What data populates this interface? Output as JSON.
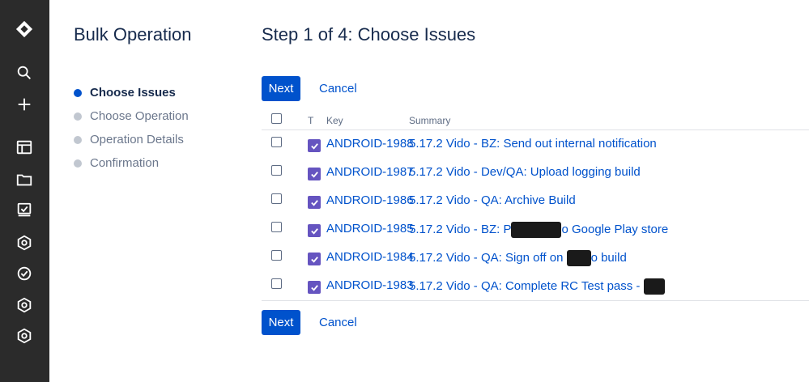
{
  "sidebar": {
    "title": "Bulk Operation",
    "steps": [
      {
        "label": "Choose Issues",
        "active": true
      },
      {
        "label": "Choose Operation",
        "active": false
      },
      {
        "label": "Operation Details",
        "active": false
      },
      {
        "label": "Confirmation",
        "active": false
      }
    ]
  },
  "main": {
    "title": "Step 1 of 4: Choose Issues",
    "next_label": "Next",
    "cancel_label": "Cancel",
    "columns": {
      "t": "T",
      "key": "Key",
      "summary": "Summary"
    },
    "rows": [
      {
        "key": "ANDROID-1988",
        "summary": "5.17.2 Vido - BZ: Send out internal notification"
      },
      {
        "key": "ANDROID-1987",
        "summary": "5.17.2 Vido - Dev/QA: Upload logging build"
      },
      {
        "key": "ANDROID-1986",
        "summary": "5.17.2 Vido - QA: Archive Build"
      },
      {
        "key": "ANDROID-1985",
        "summary_a": "5.17.2 Vido - BZ: P",
        "summary_b": "o Google Play store"
      },
      {
        "key": "ANDROID-1984",
        "summary_a": "5.17.2 Vido - QA: Sign off on ",
        "summary_b": "o build"
      },
      {
        "key": "ANDROID-1983",
        "summary_a": "5.17.2 Vido - QA: Complete RC Test pass - ",
        "summary_b": ""
      }
    ]
  },
  "colors": {
    "rail": "#2b2b2b",
    "primary": "#0052cc",
    "type_checkbox": "#6554c0"
  }
}
